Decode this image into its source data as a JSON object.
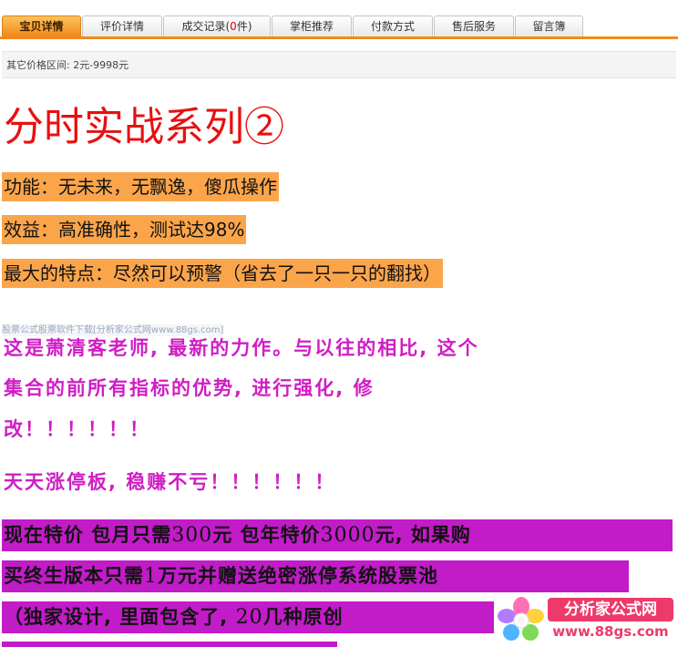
{
  "tabs": [
    {
      "label": "宝贝详情"
    },
    {
      "label": "评价详情"
    },
    {
      "label_prefix": "成交记录(",
      "label_count": "0",
      "label_suffix": "件)"
    },
    {
      "label": "掌柜推荐"
    },
    {
      "label": "付款方式"
    },
    {
      "label": "售后服务"
    },
    {
      "label": "留言簿"
    }
  ],
  "price_range": "其它价格区间: 2元-9998元",
  "content": {
    "title": "分时实战系列②",
    "highlights": [
      "功能：无未来，无飘逸，傻瓜操作",
      "效益：高准确性，测试达98%",
      "最大的特点：尽然可以预警（省去了一只一只的翻找）"
    ],
    "watermark": "股票公式股票软件下载[分析家公式网www.88gs.com]",
    "description_lines": [
      "这是萧清客老师, 最新的力作。与以往的相比, 这个",
      "集合的前所有指标的优势, 进行强化, 修",
      "改！！！！！！",
      "天天涨停板, 稳赚不亏！！！！！！"
    ],
    "offer": {
      "line1_a": "现在特价 包月只需",
      "line1_num1": "300",
      "line1_b": "元  包年特价",
      "line1_num2": "3000",
      "line1_c": "元, 如果购",
      "line2_a": "买终生版本只需",
      "line2_num": "1",
      "line2_b": "万元并赠送绝密涨停系统股票池",
      "line3_a": "（独家设计, 里面包含了, ",
      "line3_num": "20",
      "line3_b": "几种原创"
    }
  },
  "logo": {
    "icon": "flower-logo-icon",
    "title": "分析家公式网",
    "url": "www.88gs.com"
  },
  "colors": {
    "tab_accent": "#f08a1c",
    "title_red": "#e81010",
    "highlight_orange": "#fba54b",
    "text_magenta": "#d01ec4",
    "highlight_purple": "#c21bc8",
    "logo_pink": "#ee3a6a"
  }
}
